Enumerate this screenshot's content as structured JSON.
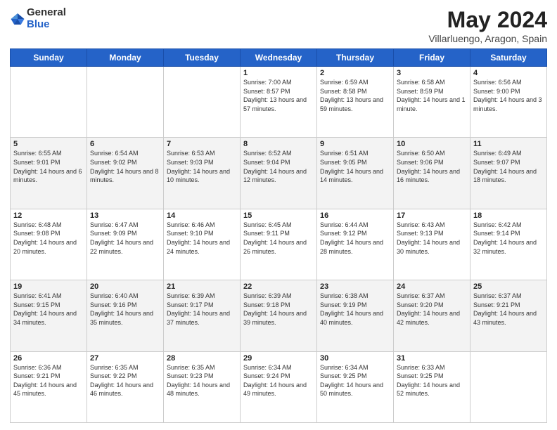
{
  "logo": {
    "general": "General",
    "blue": "Blue"
  },
  "header": {
    "title": "May 2024",
    "subtitle": "Villarluengo, Aragon, Spain"
  },
  "days_of_week": [
    "Sunday",
    "Monday",
    "Tuesday",
    "Wednesday",
    "Thursday",
    "Friday",
    "Saturday"
  ],
  "weeks": [
    [
      {
        "num": "",
        "sunrise": "",
        "sunset": "",
        "daylight": ""
      },
      {
        "num": "",
        "sunrise": "",
        "sunset": "",
        "daylight": ""
      },
      {
        "num": "",
        "sunrise": "",
        "sunset": "",
        "daylight": ""
      },
      {
        "num": "1",
        "sunrise": "Sunrise: 7:00 AM",
        "sunset": "Sunset: 8:57 PM",
        "daylight": "Daylight: 13 hours and 57 minutes."
      },
      {
        "num": "2",
        "sunrise": "Sunrise: 6:59 AM",
        "sunset": "Sunset: 8:58 PM",
        "daylight": "Daylight: 13 hours and 59 minutes."
      },
      {
        "num": "3",
        "sunrise": "Sunrise: 6:58 AM",
        "sunset": "Sunset: 8:59 PM",
        "daylight": "Daylight: 14 hours and 1 minute."
      },
      {
        "num": "4",
        "sunrise": "Sunrise: 6:56 AM",
        "sunset": "Sunset: 9:00 PM",
        "daylight": "Daylight: 14 hours and 3 minutes."
      }
    ],
    [
      {
        "num": "5",
        "sunrise": "Sunrise: 6:55 AM",
        "sunset": "Sunset: 9:01 PM",
        "daylight": "Daylight: 14 hours and 6 minutes."
      },
      {
        "num": "6",
        "sunrise": "Sunrise: 6:54 AM",
        "sunset": "Sunset: 9:02 PM",
        "daylight": "Daylight: 14 hours and 8 minutes."
      },
      {
        "num": "7",
        "sunrise": "Sunrise: 6:53 AM",
        "sunset": "Sunset: 9:03 PM",
        "daylight": "Daylight: 14 hours and 10 minutes."
      },
      {
        "num": "8",
        "sunrise": "Sunrise: 6:52 AM",
        "sunset": "Sunset: 9:04 PM",
        "daylight": "Daylight: 14 hours and 12 minutes."
      },
      {
        "num": "9",
        "sunrise": "Sunrise: 6:51 AM",
        "sunset": "Sunset: 9:05 PM",
        "daylight": "Daylight: 14 hours and 14 minutes."
      },
      {
        "num": "10",
        "sunrise": "Sunrise: 6:50 AM",
        "sunset": "Sunset: 9:06 PM",
        "daylight": "Daylight: 14 hours and 16 minutes."
      },
      {
        "num": "11",
        "sunrise": "Sunrise: 6:49 AM",
        "sunset": "Sunset: 9:07 PM",
        "daylight": "Daylight: 14 hours and 18 minutes."
      }
    ],
    [
      {
        "num": "12",
        "sunrise": "Sunrise: 6:48 AM",
        "sunset": "Sunset: 9:08 PM",
        "daylight": "Daylight: 14 hours and 20 minutes."
      },
      {
        "num": "13",
        "sunrise": "Sunrise: 6:47 AM",
        "sunset": "Sunset: 9:09 PM",
        "daylight": "Daylight: 14 hours and 22 minutes."
      },
      {
        "num": "14",
        "sunrise": "Sunrise: 6:46 AM",
        "sunset": "Sunset: 9:10 PM",
        "daylight": "Daylight: 14 hours and 24 minutes."
      },
      {
        "num": "15",
        "sunrise": "Sunrise: 6:45 AM",
        "sunset": "Sunset: 9:11 PM",
        "daylight": "Daylight: 14 hours and 26 minutes."
      },
      {
        "num": "16",
        "sunrise": "Sunrise: 6:44 AM",
        "sunset": "Sunset: 9:12 PM",
        "daylight": "Daylight: 14 hours and 28 minutes."
      },
      {
        "num": "17",
        "sunrise": "Sunrise: 6:43 AM",
        "sunset": "Sunset: 9:13 PM",
        "daylight": "Daylight: 14 hours and 30 minutes."
      },
      {
        "num": "18",
        "sunrise": "Sunrise: 6:42 AM",
        "sunset": "Sunset: 9:14 PM",
        "daylight": "Daylight: 14 hours and 32 minutes."
      }
    ],
    [
      {
        "num": "19",
        "sunrise": "Sunrise: 6:41 AM",
        "sunset": "Sunset: 9:15 PM",
        "daylight": "Daylight: 14 hours and 34 minutes."
      },
      {
        "num": "20",
        "sunrise": "Sunrise: 6:40 AM",
        "sunset": "Sunset: 9:16 PM",
        "daylight": "Daylight: 14 hours and 35 minutes."
      },
      {
        "num": "21",
        "sunrise": "Sunrise: 6:39 AM",
        "sunset": "Sunset: 9:17 PM",
        "daylight": "Daylight: 14 hours and 37 minutes."
      },
      {
        "num": "22",
        "sunrise": "Sunrise: 6:39 AM",
        "sunset": "Sunset: 9:18 PM",
        "daylight": "Daylight: 14 hours and 39 minutes."
      },
      {
        "num": "23",
        "sunrise": "Sunrise: 6:38 AM",
        "sunset": "Sunset: 9:19 PM",
        "daylight": "Daylight: 14 hours and 40 minutes."
      },
      {
        "num": "24",
        "sunrise": "Sunrise: 6:37 AM",
        "sunset": "Sunset: 9:20 PM",
        "daylight": "Daylight: 14 hours and 42 minutes."
      },
      {
        "num": "25",
        "sunrise": "Sunrise: 6:37 AM",
        "sunset": "Sunset: 9:21 PM",
        "daylight": "Daylight: 14 hours and 43 minutes."
      }
    ],
    [
      {
        "num": "26",
        "sunrise": "Sunrise: 6:36 AM",
        "sunset": "Sunset: 9:21 PM",
        "daylight": "Daylight: 14 hours and 45 minutes."
      },
      {
        "num": "27",
        "sunrise": "Sunrise: 6:35 AM",
        "sunset": "Sunset: 9:22 PM",
        "daylight": "Daylight: 14 hours and 46 minutes."
      },
      {
        "num": "28",
        "sunrise": "Sunrise: 6:35 AM",
        "sunset": "Sunset: 9:23 PM",
        "daylight": "Daylight: 14 hours and 48 minutes."
      },
      {
        "num": "29",
        "sunrise": "Sunrise: 6:34 AM",
        "sunset": "Sunset: 9:24 PM",
        "daylight": "Daylight: 14 hours and 49 minutes."
      },
      {
        "num": "30",
        "sunrise": "Sunrise: 6:34 AM",
        "sunset": "Sunset: 9:25 PM",
        "daylight": "Daylight: 14 hours and 50 minutes."
      },
      {
        "num": "31",
        "sunrise": "Sunrise: 6:33 AM",
        "sunset": "Sunset: 9:25 PM",
        "daylight": "Daylight: 14 hours and 52 minutes."
      },
      {
        "num": "",
        "sunrise": "",
        "sunset": "",
        "daylight": ""
      }
    ]
  ]
}
